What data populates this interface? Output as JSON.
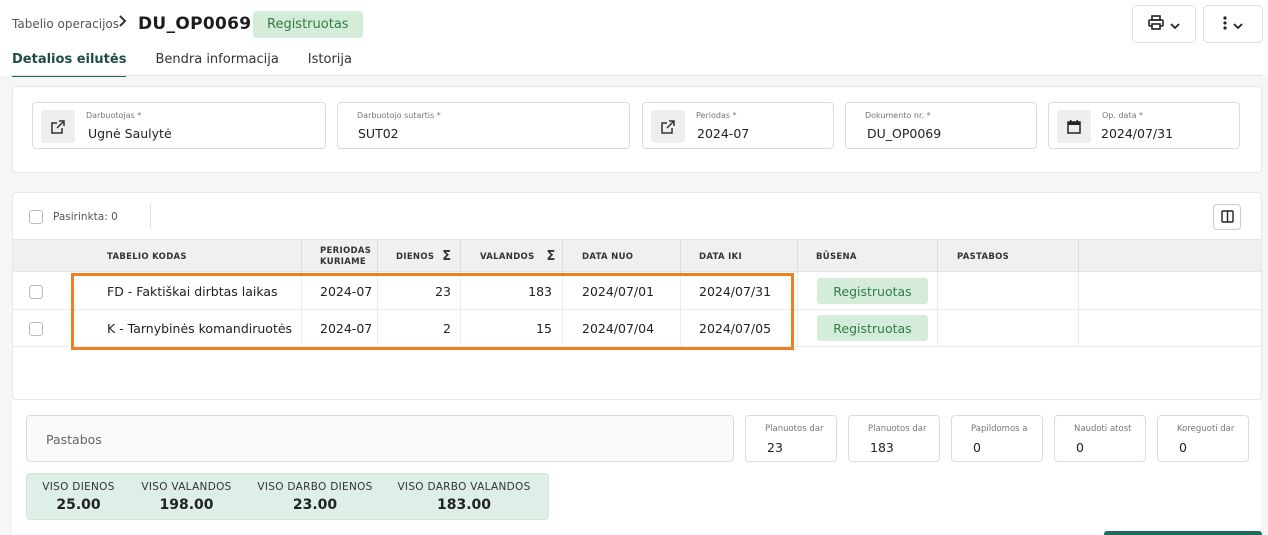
{
  "header": {
    "breadcrumb": "Tabelio operacijos",
    "title": "DU_OP0069",
    "status": "Registruotas"
  },
  "tabs": [
    {
      "label": "Detalios eilutės",
      "active": true
    },
    {
      "label": "Bendra informacija",
      "active": false
    },
    {
      "label": "Istorija",
      "active": false
    }
  ],
  "fields": {
    "employee": {
      "label": "Darbuotojas *",
      "value": "Ugnė Saulytė",
      "icon": "external-link-icon"
    },
    "contract": {
      "label": "Darbuotojo sutartis *",
      "value": "SUT02"
    },
    "period": {
      "label": "Periodas *",
      "value": "2024-07",
      "icon": "external-link-icon"
    },
    "doc_no": {
      "label": "Dokumento nr. *",
      "value": "DU_OP0069"
    },
    "op_date": {
      "label": "Op. data *",
      "value": "2024/07/31",
      "icon": "calendar-icon"
    }
  },
  "table": {
    "selected_label": "Pasirinkta: 0",
    "columns": {
      "code": "TABELIO KODAS",
      "period_l1": "PERIODAS",
      "period_l2": "KURIAME",
      "days": "DIENOS",
      "hours": "VALANDOS",
      "date_from": "DATA NUO",
      "date_to": "DATA IKI",
      "status": "BŪSENA",
      "notes": "PASTABOS",
      "sigma": "Σ"
    },
    "rows": [
      {
        "code": "FD - Faktiškai dirbtas laikas",
        "period": "2024-07",
        "days": "23",
        "hours": "183",
        "date_from": "2024/07/01",
        "date_to": "2024/07/31",
        "status": "Registruotas",
        "notes": ""
      },
      {
        "code": "K - Tarnybinės komandiruotės",
        "period": "2024-07",
        "days": "2",
        "hours": "15",
        "date_from": "2024/07/04",
        "date_to": "2024/07/05",
        "status": "Registruotas",
        "notes": ""
      }
    ]
  },
  "bottom": {
    "notes_placeholder": "Pastabos",
    "mini_fields": [
      {
        "label": "Planuotos dar",
        "value": "23"
      },
      {
        "label": "Planuotos dar",
        "value": "183"
      },
      {
        "label": "Papildomos a",
        "value": "0"
      },
      {
        "label": "Naudoti atost",
        "value": "0"
      },
      {
        "label": "Koreguoti dar",
        "value": "0"
      }
    ],
    "totals": [
      {
        "label": "VISO DIENOS",
        "value": "25.00"
      },
      {
        "label": "VISO VALANDOS",
        "value": "198.00"
      },
      {
        "label": "VISO DARBO DIENOS",
        "value": "23.00"
      },
      {
        "label": "VISO DARBO VALANDOS",
        "value": "183.00"
      }
    ]
  },
  "colors": {
    "accent": "#1e6b5a",
    "status_bg": "#d4ecd9",
    "status_text": "#2f7d45",
    "highlight": "#f07f1f",
    "totals_bg": "#ddefe7"
  }
}
